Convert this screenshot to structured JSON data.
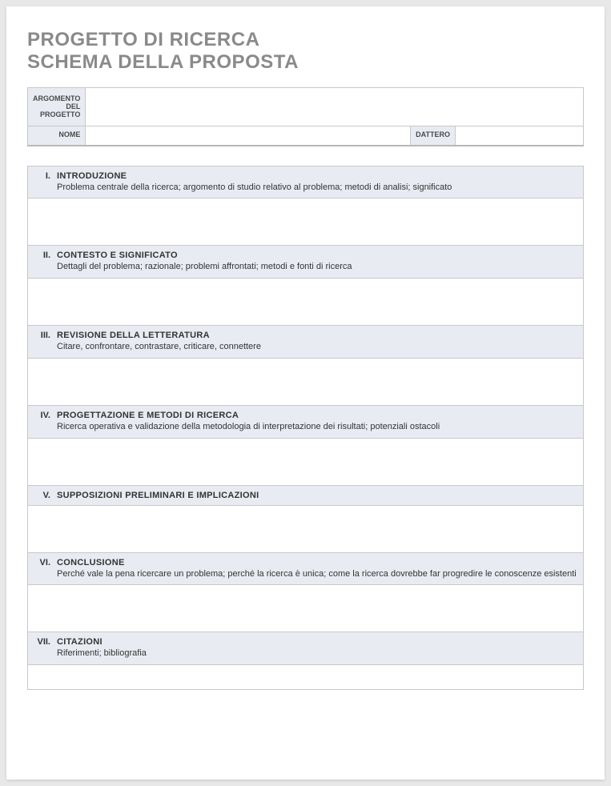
{
  "title_line1": "PROGETTO DI RICERCA",
  "title_line2": "SCHEMA DELLA PROPOSTA",
  "info": {
    "topic_label": "ARGOMENTO DEL PROGETTO",
    "topic_value": "",
    "name_label": "NOME",
    "name_value": "",
    "date_label": "DATTERO",
    "date_value": ""
  },
  "sections": [
    {
      "num": "I.",
      "title": "INTRODUZIONE",
      "subtitle": "Problema centrale della ricerca; argomento di studio relativo al problema; metodi di analisi; significato",
      "body": ""
    },
    {
      "num": "II.",
      "title": "CONTESTO E SIGNIFICATO",
      "subtitle": "Dettagli del problema; razionale; problemi affrontati; metodi e fonti di ricerca",
      "body": ""
    },
    {
      "num": "III.",
      "title": "REVISIONE DELLA LETTERATURA",
      "subtitle": "Citare, confrontare, contrastare, criticare, connettere",
      "body": ""
    },
    {
      "num": "IV.",
      "title": "PROGETTAZIONE E METODI DI RICERCA",
      "subtitle": "Ricerca operativa e validazione della metodologia di interpretazione dei risultati; potenziali ostacoli",
      "body": ""
    },
    {
      "num": "V.",
      "title": "SUPPOSIZIONI PRELIMINARI E IMPLICAZIONI",
      "subtitle": "",
      "body": ""
    },
    {
      "num": "VI.",
      "title": "CONCLUSIONE",
      "subtitle": "Perché vale la pena ricercare un problema; perché la ricerca è unica; come la ricerca dovrebbe far progredire le conoscenze esistenti",
      "body": ""
    },
    {
      "num": "VII.",
      "title": "CITAZIONI",
      "subtitle": "Riferimenti; bibliografia",
      "body": ""
    }
  ]
}
